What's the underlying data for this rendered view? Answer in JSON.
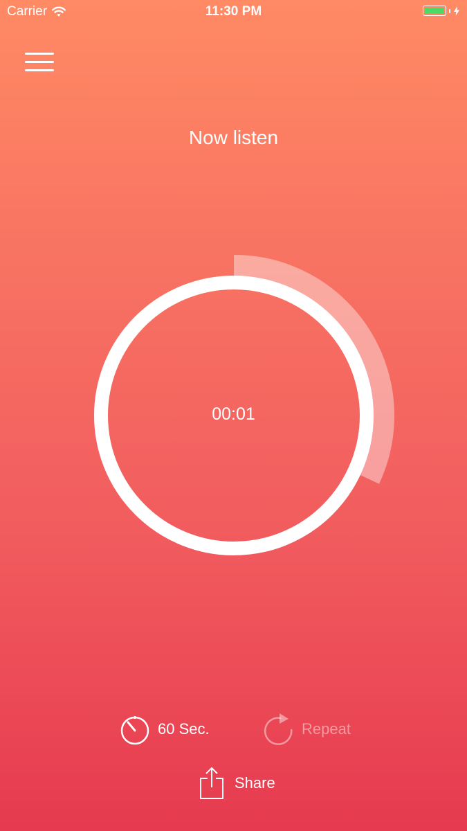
{
  "status_bar": {
    "carrier": "Carrier",
    "time": "11:30 PM",
    "battery_color": "#4cd964"
  },
  "menu": {
    "icon": "hamburger-menu-icon"
  },
  "header": {
    "title": "Now listen"
  },
  "timer": {
    "elapsed": "00:01",
    "progress_fraction": 0.32,
    "ring_color": "#ffffff",
    "progress_color": "rgba(255,255,255,0.4)"
  },
  "controls": {
    "duration_label": "60 Sec.",
    "duration_icon": "stopwatch-icon",
    "repeat_label": "Repeat",
    "repeat_icon": "repeat-icon",
    "repeat_enabled": false,
    "share_label": "Share",
    "share_icon": "share-icon"
  },
  "theme": {
    "gradient_top": "#ff8a64",
    "gradient_bottom": "#e63a4f"
  }
}
